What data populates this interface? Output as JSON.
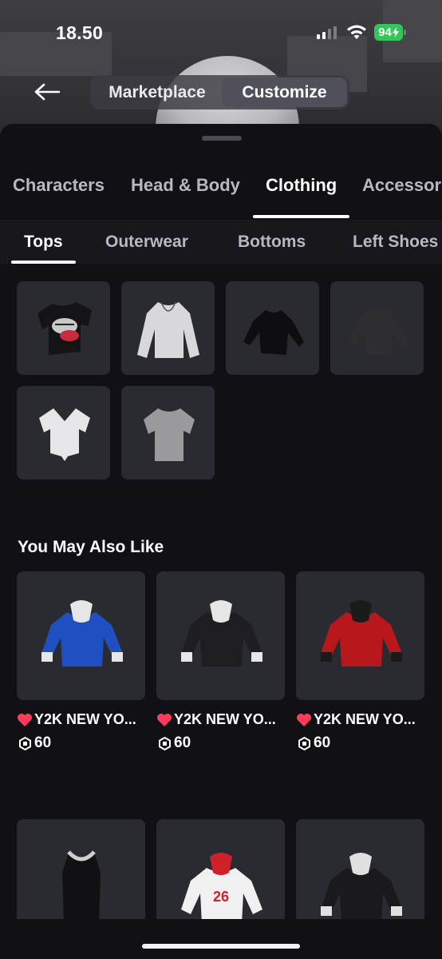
{
  "status_bar": {
    "time": "18.50",
    "battery": "94"
  },
  "header": {
    "segment": [
      "Marketplace",
      "Customize"
    ],
    "active_segment": "Customize"
  },
  "category_tabs": [
    "Characters",
    "Head & Body",
    "Clothing",
    "Accessor"
  ],
  "active_category": "Clothing",
  "subcategory_tabs": [
    "Tops",
    "Outerwear",
    "Bottoms",
    "Left Shoes"
  ],
  "active_subcategory": "Tops",
  "owned_items": [
    {
      "icon": "graphic-tshirt-icon"
    },
    {
      "icon": "white-longsleeve-icon"
    },
    {
      "icon": "black-longsleeve-icon"
    },
    {
      "icon": "dark-longsleeve-icon"
    },
    {
      "icon": "white-tied-shirt-icon"
    },
    {
      "icon": "grey-tshirt-icon"
    }
  ],
  "recommendations": {
    "title": "You May Also Like",
    "items": [
      {
        "name": "Y2K NEW YO...",
        "price": "60",
        "color": "#1f4fc0"
      },
      {
        "name": "Y2K NEW YO...",
        "price": "60",
        "color": "#1e1e22"
      },
      {
        "name": "Y2K NEW YO...",
        "price": "60",
        "color": "#b8181c"
      }
    ],
    "more_items": [
      {
        "icon": "black-tank-top-icon"
      },
      {
        "icon": "red-white-jersey-icon"
      },
      {
        "icon": "black-jersey-icon"
      }
    ]
  },
  "colors": {
    "background": "#101015",
    "tile": "#2a2a31",
    "battery": "#32c758",
    "heart": "#ff3b5c"
  }
}
